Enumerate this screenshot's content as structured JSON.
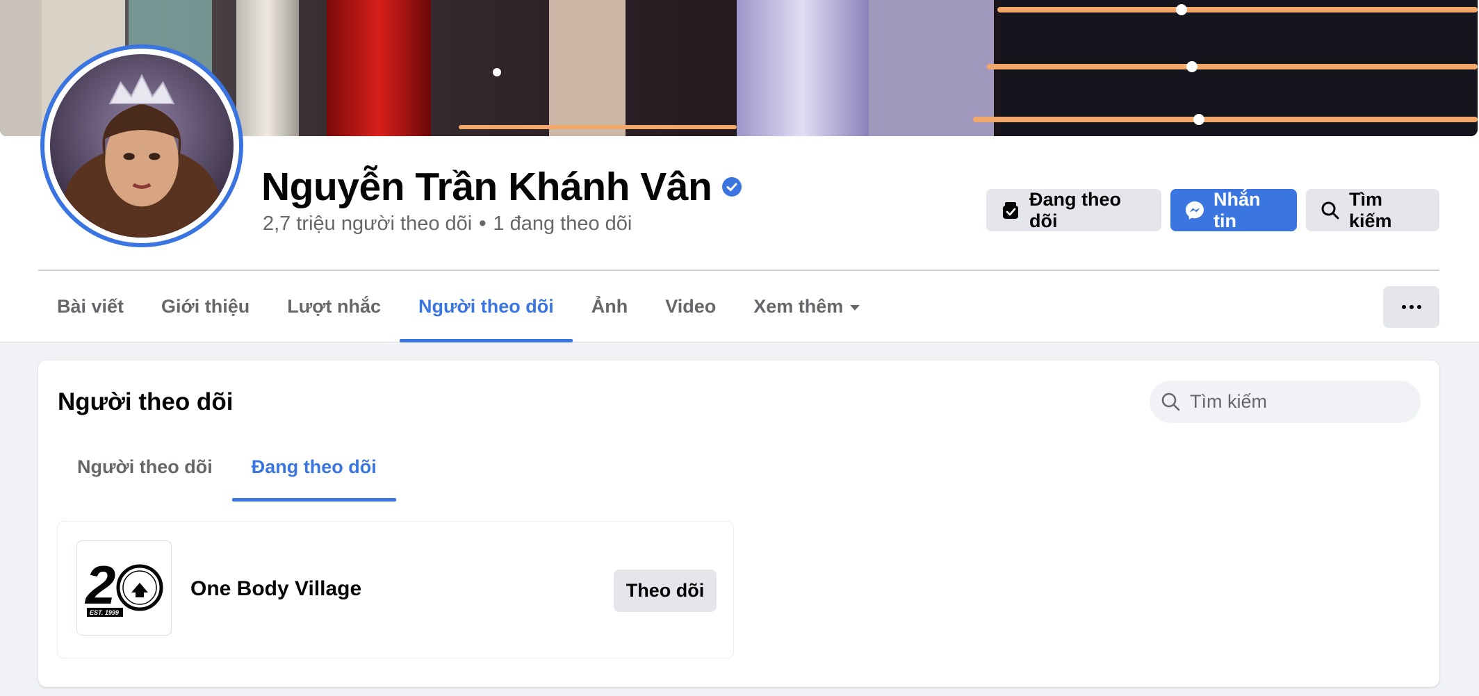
{
  "profile": {
    "name": "Nguyễn Trần Khánh Vân",
    "followers_text": "2,7 triệu người theo dõi",
    "separator": "•",
    "following_text": "1 đang theo dõi",
    "verified_icon": "verified-badge-icon"
  },
  "actions": {
    "following_label": "Đang theo dõi",
    "message_label": "Nhắn tin",
    "search_label": "Tìm kiếm"
  },
  "nav": {
    "tabs": [
      {
        "label": "Bài viết"
      },
      {
        "label": "Giới thiệu"
      },
      {
        "label": "Lượt nhắc"
      },
      {
        "label": "Người theo dõi",
        "active": true
      },
      {
        "label": "Ảnh"
      },
      {
        "label": "Video"
      },
      {
        "label": "Xem thêm"
      }
    ]
  },
  "section": {
    "title": "Người theo dõi",
    "search_placeholder": "Tìm kiếm",
    "subtabs": [
      {
        "label": "Người theo dõi"
      },
      {
        "label": "Đang theo dõi",
        "active": true
      }
    ]
  },
  "following_list": [
    {
      "name": "One Body Village",
      "button_label": "Theo dõi",
      "logo_text": "EST. 1999"
    }
  ],
  "colors": {
    "accent": "#3b75e0",
    "button_grey": "#e4e6eb",
    "page_bg": "#f0f2f5",
    "secondary_text": "#65676b"
  }
}
